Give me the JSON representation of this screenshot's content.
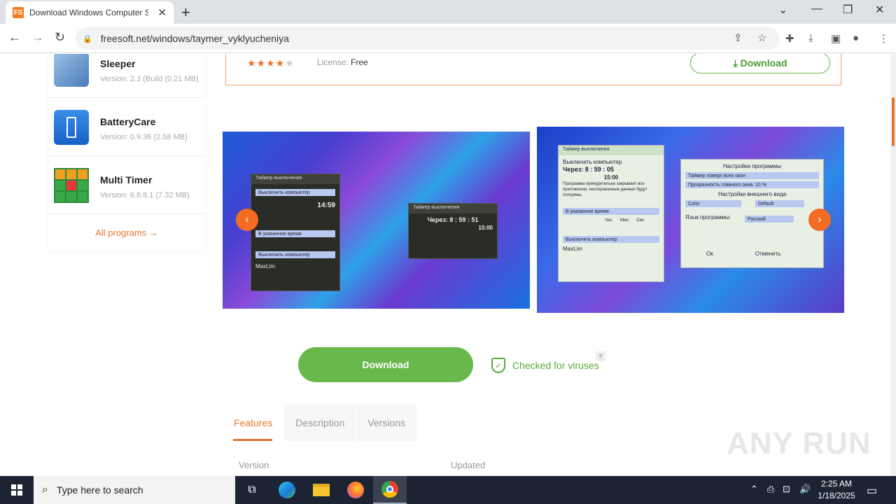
{
  "browser": {
    "tab_title": "Download Windows Computer S",
    "favicon_text": "FS",
    "url": "freesoft.net/windows/taymer_vyklyucheniya",
    "icons": [
      "back-icon",
      "forward-icon",
      "reload-icon",
      "lock-icon",
      "share-icon",
      "star-icon",
      "extensions-icon",
      "download-icon",
      "sidepanel-icon",
      "profile-icon",
      "menu-icon"
    ]
  },
  "sidebar": {
    "items": [
      {
        "name": "Sleeper",
        "version": "Version: 2.3 (Build (0.21 MB)"
      },
      {
        "name": "BatteryCare",
        "version": "Version: 0.9.36 (2.58 MB)"
      },
      {
        "name": "Multi Timer",
        "version": "Version: 6.8.8.1 (7.32 MB)"
      }
    ],
    "all_programs": "All programs →"
  },
  "info": {
    "rating": 4,
    "license_label": "License:",
    "license_value": "Free",
    "download_label": "Download"
  },
  "screens": {
    "shot1": {
      "title": "Таймер выключения",
      "action": "Выключить компьютер",
      "time": "14:59",
      "countdown": "Через: 8 : 59 : 51",
      "countdown_time": "15:00",
      "mode": "В указанное время",
      "footer": "MaxLim"
    },
    "shot2": {
      "title": "Таймер выключения",
      "action": "Выключить компьютер",
      "countdown": "Через: 8 : 59 : 05",
      "time": "15:00",
      "warning": "Программа принудительно закрывает все приложения, несохраненные данные будут потеряны.",
      "mode": "В указанное время",
      "hours_label": "Час.",
      "minutes_label": "Мин.",
      "seconds_label": "Сек.",
      "settings_title": "Настройки программы",
      "always_on_top": "Таймер поверх всех окон",
      "opacity": "Прозрачность главного окна: 10 %",
      "appearance": "Настройки внешнего вида",
      "color": "Color",
      "default": "Default",
      "language_label": "Язык программы:",
      "language": "Русский",
      "ok": "Ок",
      "cancel": "Отменить",
      "footer": "MaxLim"
    }
  },
  "actions": {
    "download": "Download",
    "virus_check": "Checked for viruses",
    "help": "?"
  },
  "tabs": [
    {
      "label": "Features",
      "active": true
    },
    {
      "label": "Description",
      "active": false
    },
    {
      "label": "Versions",
      "active": false
    }
  ],
  "columns": {
    "version": "Version",
    "updated": "Updated"
  },
  "watermark": "ANY RUN",
  "taskbar": {
    "search_placeholder": "Type here to search",
    "time": "2:25 AM",
    "date": "1/18/2025"
  },
  "colors": {
    "accent": "#e8772e",
    "green": "#69b84c",
    "taskbar": "#1c2433"
  }
}
